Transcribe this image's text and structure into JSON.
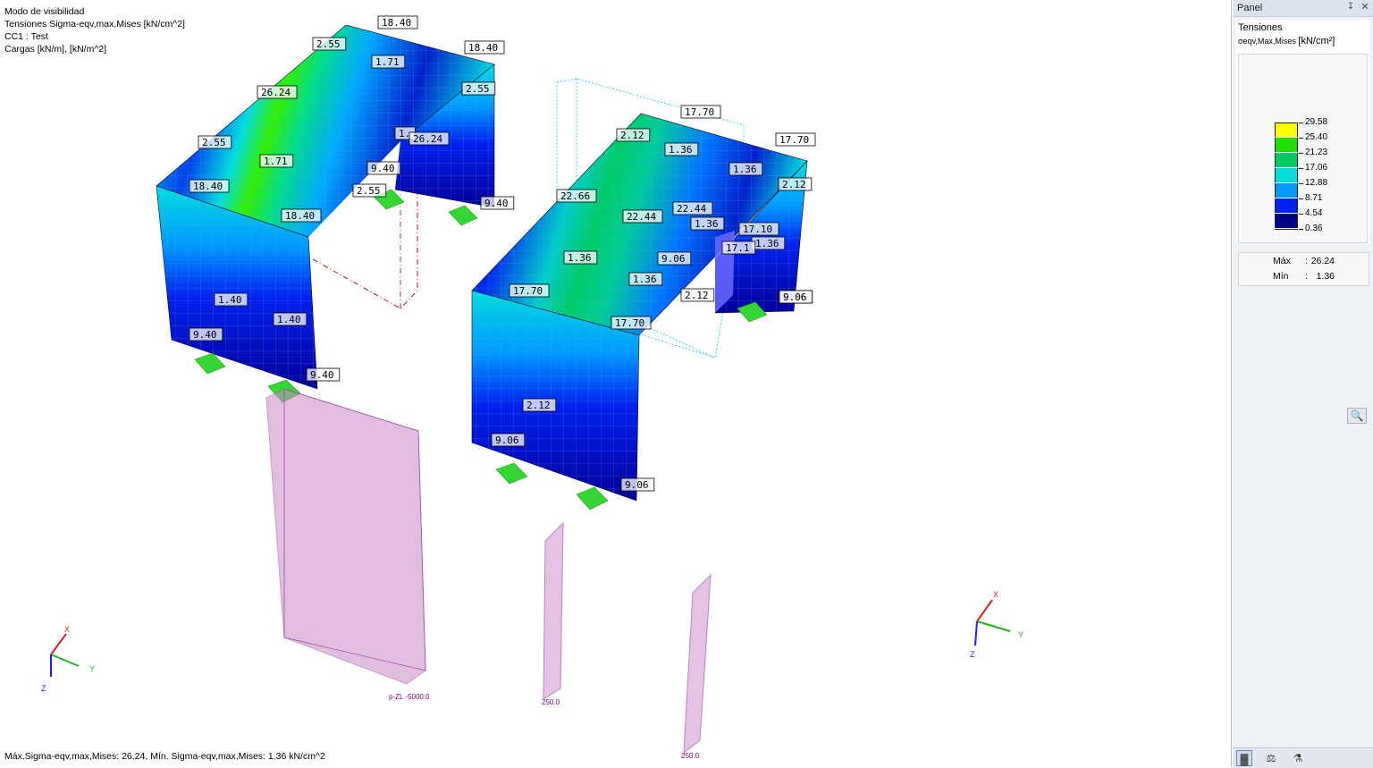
{
  "viewport": {
    "info_lines": [
      "Modo de visibilidad",
      "Tensiones Sigma-eqv,max,Mises [kN/cm^2]",
      "CC1 : Test",
      "Cargas [kN/m], [kN/m^2]"
    ],
    "status_line": "Máx.Sigma-eqv,max,Mises: 26.24, Mín. Sigma-eqv,max,Mises: 1.36 kN/cm^2",
    "axes_left": {
      "x": "X",
      "y": "Y",
      "z": "Z"
    },
    "axes_right": {
      "x": "X",
      "y": "Y",
      "z": "Z"
    },
    "value_labels": [
      "18.40",
      "18.40",
      "2.55",
      "1.71",
      "2.55",
      "26.24",
      "1.",
      "26.24",
      "2.55",
      "1.71",
      "9.40",
      "2.55",
      "9.40",
      "18.40",
      "18.40",
      "1.40",
      "1.40",
      "9.40",
      "9.40",
      "17.70",
      "17.70",
      "2.12",
      "1.36",
      "1.36",
      "2.12",
      "22.66",
      "22.44",
      "22.44",
      "1.36",
      "17.10",
      "1.36",
      "17.1",
      "2.12",
      "1.36",
      "9.06",
      "17.70",
      "1.36",
      "2.12",
      "17.70",
      "9.06",
      "1.36",
      "9.06",
      "9.06"
    ],
    "load_labels": [
      "p-ZL -5000.0",
      "250.0",
      "250.0"
    ],
    "colors": {
      "support": "#33d633",
      "load": "#cc88cc",
      "member_line": "#a00000",
      "frame": "#00ccee"
    }
  },
  "panel": {
    "title": "Panel",
    "pin_icon": "pin-icon",
    "close_icon": "close-icon",
    "section": "Tensiones",
    "quantity": "σeqv,Max,Mises",
    "unit": "[kN/cm²]",
    "legend": [
      {
        "value": "29.58",
        "color": "#ffff00"
      },
      {
        "value": "25.40",
        "color": "#22dd00"
      },
      {
        "value": "21.23",
        "color": "#00cc66"
      },
      {
        "value": "17.06",
        "color": "#00dddd"
      },
      {
        "value": "12.88",
        "color": "#0099ff"
      },
      {
        "value": "8.71",
        "color": "#0022ee"
      },
      {
        "value": "4.54",
        "color": "#000088"
      },
      {
        "value": "0.36",
        "color": null
      }
    ],
    "max_label": "Máx",
    "max_value": "26.24",
    "min_label": "Mín",
    "min_value": "1.36",
    "toolbar_icons": [
      "color-scale-icon",
      "balance-icon",
      "microscope-icon"
    ],
    "zoom_icon": "zoom-icon"
  }
}
